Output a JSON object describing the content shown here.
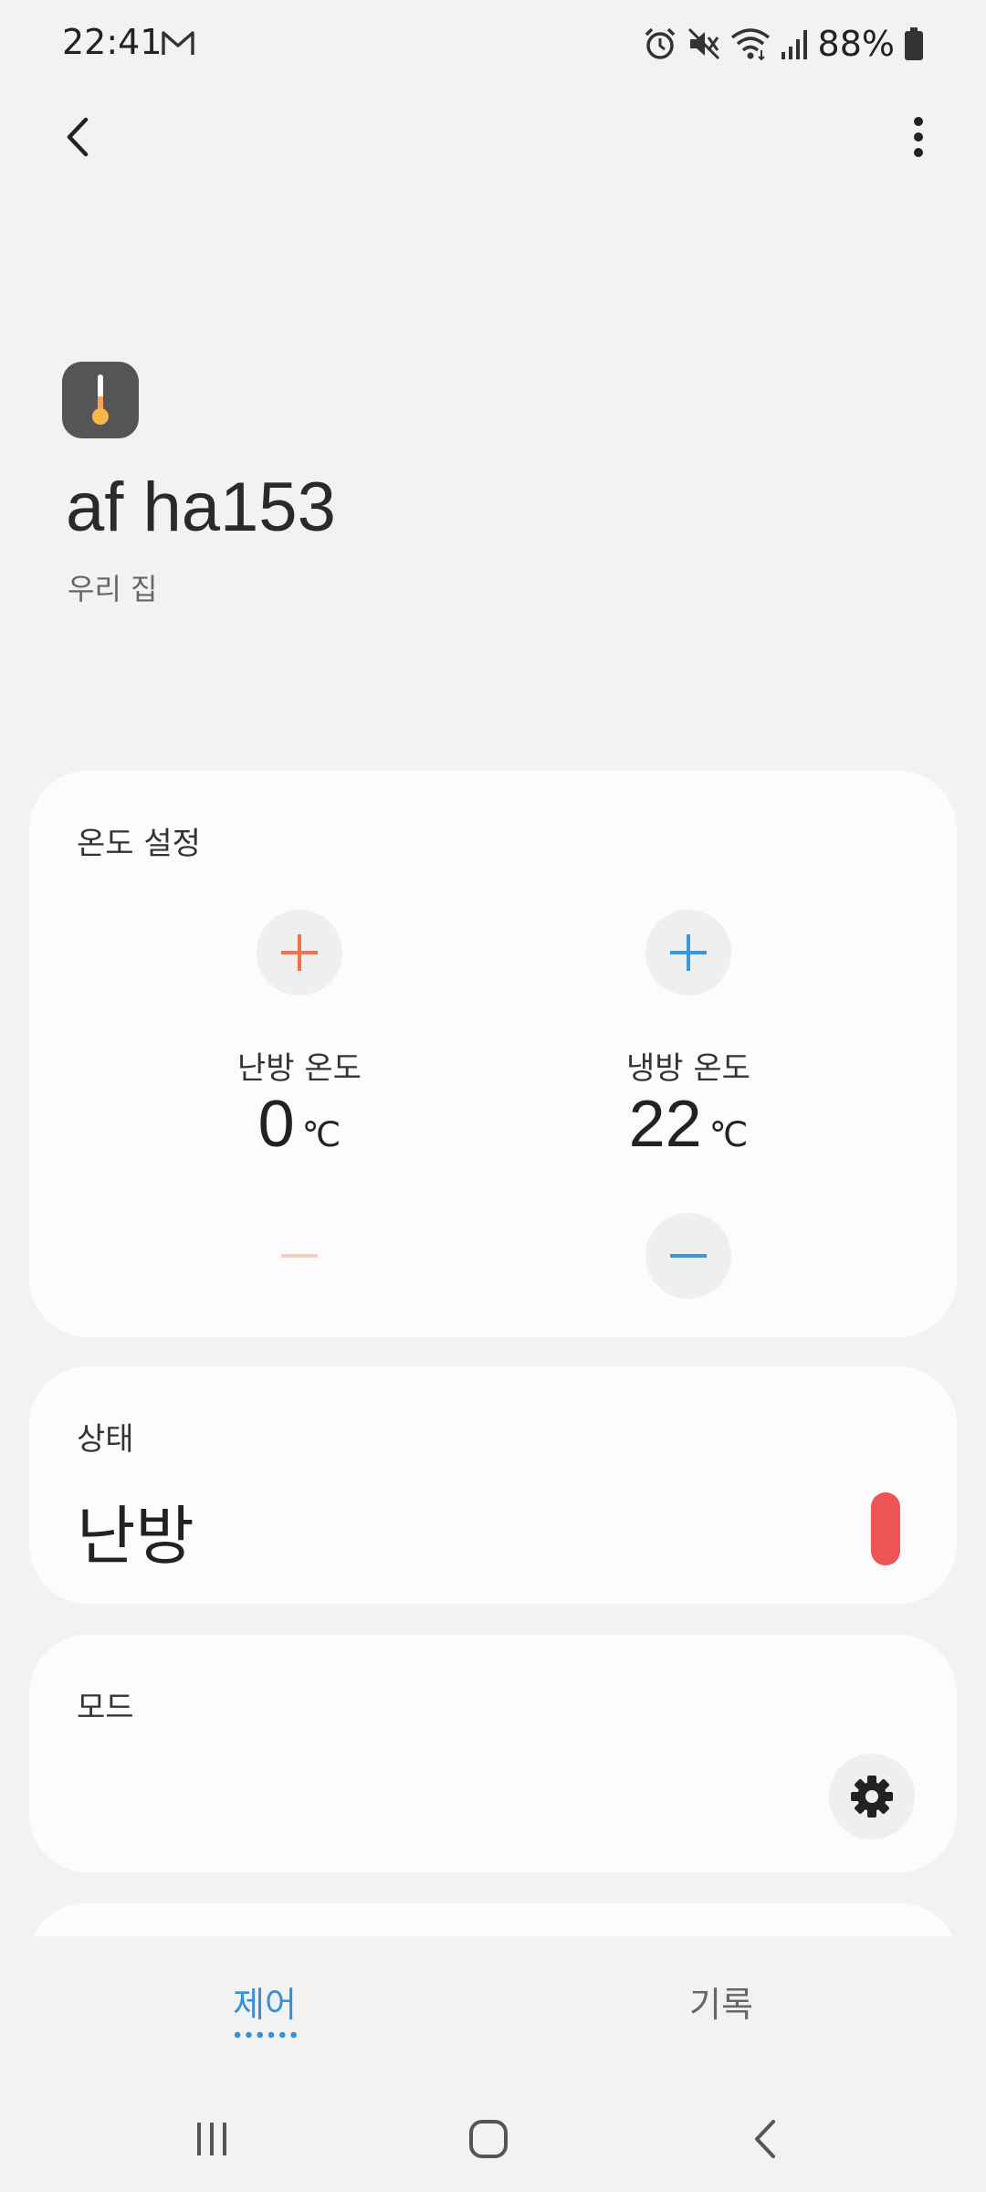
{
  "status_bar": {
    "time": "22:41",
    "battery": "88%",
    "icons": [
      "gmail-icon",
      "alarm-icon",
      "mute-icon",
      "wifi-icon",
      "signal-icon",
      "battery-icon"
    ]
  },
  "device": {
    "icon": "thermometer-icon",
    "name": "af ha153",
    "location": "우리 집"
  },
  "temperature_card": {
    "title": "온도 설정",
    "heating": {
      "label": "난방 온도",
      "value": "0",
      "unit": "℃",
      "color": "#f0734f"
    },
    "cooling": {
      "label": "냉방 온도",
      "value": "22",
      "unit": "℃",
      "color": "#3a98e0"
    }
  },
  "status_card": {
    "title": "상태",
    "value": "난방",
    "indicator_color": "#ef5454"
  },
  "mode_card": {
    "title": "모드",
    "action_icon": "gear-icon"
  },
  "tabs": [
    {
      "label": "제어",
      "active": true
    },
    {
      "label": "기록",
      "active": false
    }
  ],
  "colors": {
    "accent": "#3a8fd9",
    "background": "#f2f2f2",
    "card": "#fcfcfc"
  }
}
